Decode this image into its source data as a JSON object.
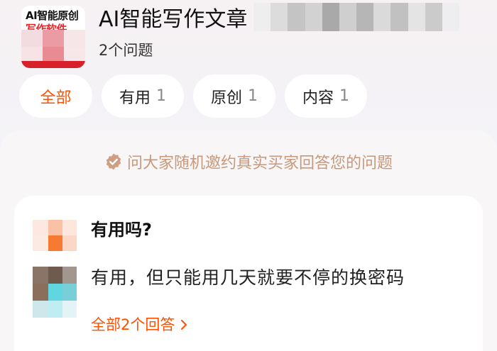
{
  "product": {
    "thumb_line1": "AI智能原创",
    "thumb_line2": "写作软件",
    "title": "AI智能写作文章",
    "question_count": "2个问题"
  },
  "tabs": [
    {
      "label": "全部",
      "count": "",
      "active": true
    },
    {
      "label": "有用",
      "count": "1",
      "active": false
    },
    {
      "label": "原创",
      "count": "1",
      "active": false
    },
    {
      "label": "内容",
      "count": "1",
      "active": false
    }
  ],
  "invite": {
    "text": "问大家随机邀约真实买家回答您的问题",
    "icon": "verified-badge-icon"
  },
  "qa_card": {
    "question": "有用吗?",
    "answer": "有用，但只能用几天就要不停的换密码",
    "all_answers_link": "全部2个回答",
    "link_icon": "chevron-right-icon"
  },
  "colors": {
    "accent": "#ff5000",
    "invite_text": "#c6987c",
    "tab_count": "#8a8a8a"
  }
}
